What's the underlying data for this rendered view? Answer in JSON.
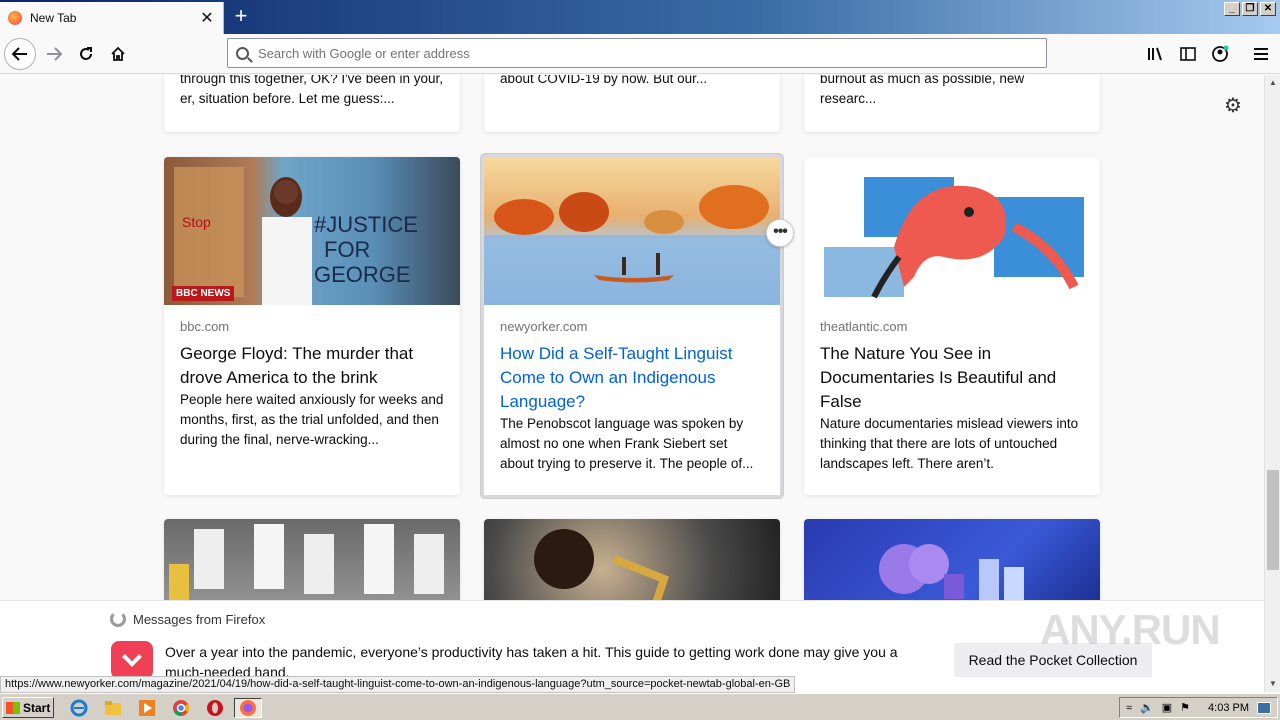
{
  "browser": {
    "tab_title": "New Tab",
    "tab_close": "✕",
    "new_tab": "+",
    "window_controls": [
      "_",
      "❐",
      "✕"
    ],
    "url_placeholder": "Search with Google or enter address"
  },
  "toolbar": {
    "icons": [
      "back-icon",
      "forward-icon",
      "reload-icon",
      "home-icon",
      "library-icon",
      "sidebar-icon",
      "account-icon",
      "menu-icon"
    ]
  },
  "feed": {
    "top_row": [
      {
        "excerpt": "through this together, OK? I've been in your, er, situation before. Let me guess:..."
      },
      {
        "excerpt": "about COVID-19 by now. But our..."
      },
      {
        "excerpt": "burnout as much as possible, new researc..."
      }
    ],
    "cards": [
      {
        "source": "bbc.com",
        "headline": "George Floyd: The murder that drove America to the brink",
        "excerpt": "People here waited anxiously for weeks and months, first, as the trial unfolded, and then during the final, nerve-wracking...",
        "badge": "BBC NEWS"
      },
      {
        "source": "newyorker.com",
        "headline": "How Did a Self-Taught Linguist Come to Own an Indigenous Language?",
        "excerpt": "The Penobscot language was spoken by almost no one when Frank Siebert set about trying to preserve it. The people of..."
      },
      {
        "source": "theatlantic.com",
        "headline": "The Nature You See in Documentaries Is Beautiful and False",
        "excerpt": "Nature documentaries mislead viewers into thinking that there are lots of untouched landscapes left. There aren’t."
      }
    ],
    "context_menu": "•••"
  },
  "message": {
    "header": "Messages from Firefox",
    "text": "Over a year into the pandemic, everyone’s productivity has taken a hit. This guide to getting work done may give you a much-needed hand.",
    "button": "Read the Pocket Collection"
  },
  "watermark": "ANY.RUN",
  "status_url": "https://www.newyorker.com/magazine/2021/04/19/how-did-a-self-taught-linguist-come-to-own-an-indigenous-language?utm_source=pocket-newtab-global-en-GB",
  "taskbar": {
    "start": "Start",
    "clock": "4:03 PM"
  },
  "colors": {
    "link_hover": "#0060df",
    "pocket": "#ef4056",
    "bbc_red": "#bb1919"
  }
}
